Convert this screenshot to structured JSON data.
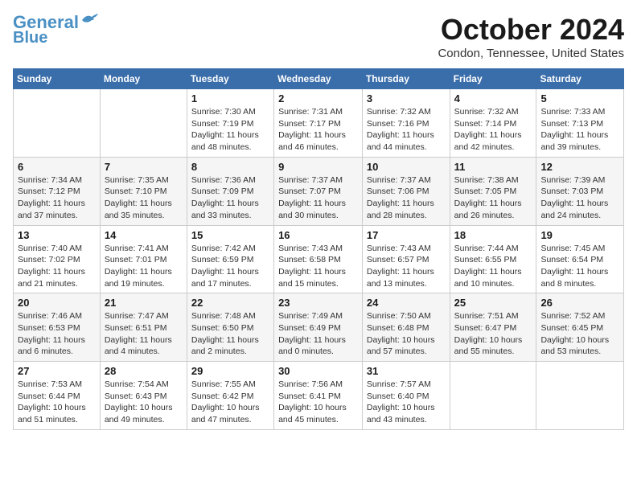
{
  "logo": {
    "line1": "General",
    "line2": "Blue"
  },
  "header": {
    "month": "October 2024",
    "location": "Condon, Tennessee, United States"
  },
  "weekdays": [
    "Sunday",
    "Monday",
    "Tuesday",
    "Wednesday",
    "Thursday",
    "Friday",
    "Saturday"
  ],
  "weeks": [
    [
      {
        "day": "",
        "detail": ""
      },
      {
        "day": "",
        "detail": ""
      },
      {
        "day": "1",
        "detail": "Sunrise: 7:30 AM\nSunset: 7:19 PM\nDaylight: 11 hours and 48 minutes."
      },
      {
        "day": "2",
        "detail": "Sunrise: 7:31 AM\nSunset: 7:17 PM\nDaylight: 11 hours and 46 minutes."
      },
      {
        "day": "3",
        "detail": "Sunrise: 7:32 AM\nSunset: 7:16 PM\nDaylight: 11 hours and 44 minutes."
      },
      {
        "day": "4",
        "detail": "Sunrise: 7:32 AM\nSunset: 7:14 PM\nDaylight: 11 hours and 42 minutes."
      },
      {
        "day": "5",
        "detail": "Sunrise: 7:33 AM\nSunset: 7:13 PM\nDaylight: 11 hours and 39 minutes."
      }
    ],
    [
      {
        "day": "6",
        "detail": "Sunrise: 7:34 AM\nSunset: 7:12 PM\nDaylight: 11 hours and 37 minutes."
      },
      {
        "day": "7",
        "detail": "Sunrise: 7:35 AM\nSunset: 7:10 PM\nDaylight: 11 hours and 35 minutes."
      },
      {
        "day": "8",
        "detail": "Sunrise: 7:36 AM\nSunset: 7:09 PM\nDaylight: 11 hours and 33 minutes."
      },
      {
        "day": "9",
        "detail": "Sunrise: 7:37 AM\nSunset: 7:07 PM\nDaylight: 11 hours and 30 minutes."
      },
      {
        "day": "10",
        "detail": "Sunrise: 7:37 AM\nSunset: 7:06 PM\nDaylight: 11 hours and 28 minutes."
      },
      {
        "day": "11",
        "detail": "Sunrise: 7:38 AM\nSunset: 7:05 PM\nDaylight: 11 hours and 26 minutes."
      },
      {
        "day": "12",
        "detail": "Sunrise: 7:39 AM\nSunset: 7:03 PM\nDaylight: 11 hours and 24 minutes."
      }
    ],
    [
      {
        "day": "13",
        "detail": "Sunrise: 7:40 AM\nSunset: 7:02 PM\nDaylight: 11 hours and 21 minutes."
      },
      {
        "day": "14",
        "detail": "Sunrise: 7:41 AM\nSunset: 7:01 PM\nDaylight: 11 hours and 19 minutes."
      },
      {
        "day": "15",
        "detail": "Sunrise: 7:42 AM\nSunset: 6:59 PM\nDaylight: 11 hours and 17 minutes."
      },
      {
        "day": "16",
        "detail": "Sunrise: 7:43 AM\nSunset: 6:58 PM\nDaylight: 11 hours and 15 minutes."
      },
      {
        "day": "17",
        "detail": "Sunrise: 7:43 AM\nSunset: 6:57 PM\nDaylight: 11 hours and 13 minutes."
      },
      {
        "day": "18",
        "detail": "Sunrise: 7:44 AM\nSunset: 6:55 PM\nDaylight: 11 hours and 10 minutes."
      },
      {
        "day": "19",
        "detail": "Sunrise: 7:45 AM\nSunset: 6:54 PM\nDaylight: 11 hours and 8 minutes."
      }
    ],
    [
      {
        "day": "20",
        "detail": "Sunrise: 7:46 AM\nSunset: 6:53 PM\nDaylight: 11 hours and 6 minutes."
      },
      {
        "day": "21",
        "detail": "Sunrise: 7:47 AM\nSunset: 6:51 PM\nDaylight: 11 hours and 4 minutes."
      },
      {
        "day": "22",
        "detail": "Sunrise: 7:48 AM\nSunset: 6:50 PM\nDaylight: 11 hours and 2 minutes."
      },
      {
        "day": "23",
        "detail": "Sunrise: 7:49 AM\nSunset: 6:49 PM\nDaylight: 11 hours and 0 minutes."
      },
      {
        "day": "24",
        "detail": "Sunrise: 7:50 AM\nSunset: 6:48 PM\nDaylight: 10 hours and 57 minutes."
      },
      {
        "day": "25",
        "detail": "Sunrise: 7:51 AM\nSunset: 6:47 PM\nDaylight: 10 hours and 55 minutes."
      },
      {
        "day": "26",
        "detail": "Sunrise: 7:52 AM\nSunset: 6:45 PM\nDaylight: 10 hours and 53 minutes."
      }
    ],
    [
      {
        "day": "27",
        "detail": "Sunrise: 7:53 AM\nSunset: 6:44 PM\nDaylight: 10 hours and 51 minutes."
      },
      {
        "day": "28",
        "detail": "Sunrise: 7:54 AM\nSunset: 6:43 PM\nDaylight: 10 hours and 49 minutes."
      },
      {
        "day": "29",
        "detail": "Sunrise: 7:55 AM\nSunset: 6:42 PM\nDaylight: 10 hours and 47 minutes."
      },
      {
        "day": "30",
        "detail": "Sunrise: 7:56 AM\nSunset: 6:41 PM\nDaylight: 10 hours and 45 minutes."
      },
      {
        "day": "31",
        "detail": "Sunrise: 7:57 AM\nSunset: 6:40 PM\nDaylight: 10 hours and 43 minutes."
      },
      {
        "day": "",
        "detail": ""
      },
      {
        "day": "",
        "detail": ""
      }
    ]
  ]
}
